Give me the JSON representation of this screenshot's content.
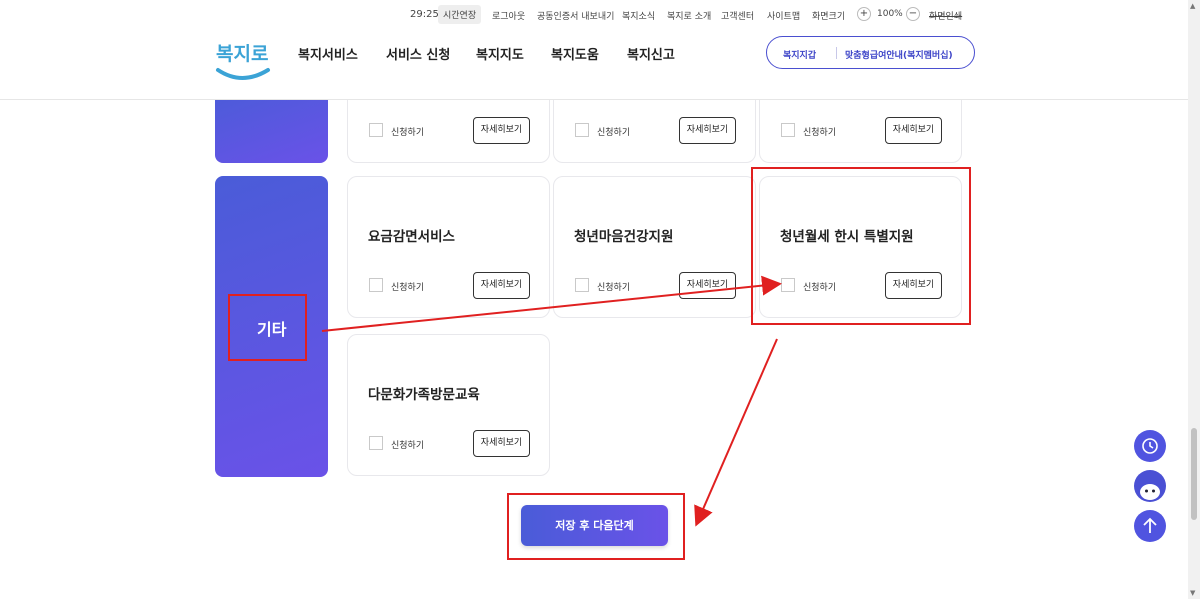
{
  "utility_bar": {
    "time": "29:25",
    "extend": "시간연장",
    "logout": "로그아웃",
    "cert_export": "공동인증서 내보내기",
    "news": "복지소식",
    "about": "복지로 소개",
    "customer": "고객센터",
    "sitemap": "사이트맵",
    "zoom_label": "화면크기",
    "zoom_in": "+",
    "zoom_value": "100%",
    "zoom_out": "−",
    "print": "화면인쇄"
  },
  "header": {
    "logo_text": "복지로",
    "nav": [
      "복지서비스",
      "서비스 신청",
      "복지지도",
      "복지도움",
      "복지신고"
    ],
    "pill": {
      "left": "복지지갑",
      "right": "맞춤형급여안내(복지멤버십)"
    }
  },
  "categories": [
    {
      "label": "기타"
    }
  ],
  "cards": [
    {
      "title": "",
      "check": "신청하기",
      "detail": "자세히보기"
    },
    {
      "title": "",
      "check": "신청하기",
      "detail": "자세히보기"
    },
    {
      "title": "",
      "check": "신청하기",
      "detail": "자세히보기"
    },
    {
      "title": "요금감면서비스",
      "check": "신청하기",
      "detail": "자세히보기"
    },
    {
      "title": "청년마음건강지원",
      "check": "신청하기",
      "detail": "자세히보기"
    },
    {
      "title": "청년월세 한시 특별지원",
      "check": "신청하기",
      "detail": "자세히보기"
    },
    {
      "title": "다문화가족방문교육",
      "check": "신청하기",
      "detail": "자세히보기"
    }
  ],
  "main_button": "저장 후 다음단계",
  "fab_icons": [
    "history-icon",
    "chatbot-icon",
    "arrow-up-icon"
  ],
  "colors": {
    "accent": "#5054e0",
    "annotation": "#e02020"
  }
}
